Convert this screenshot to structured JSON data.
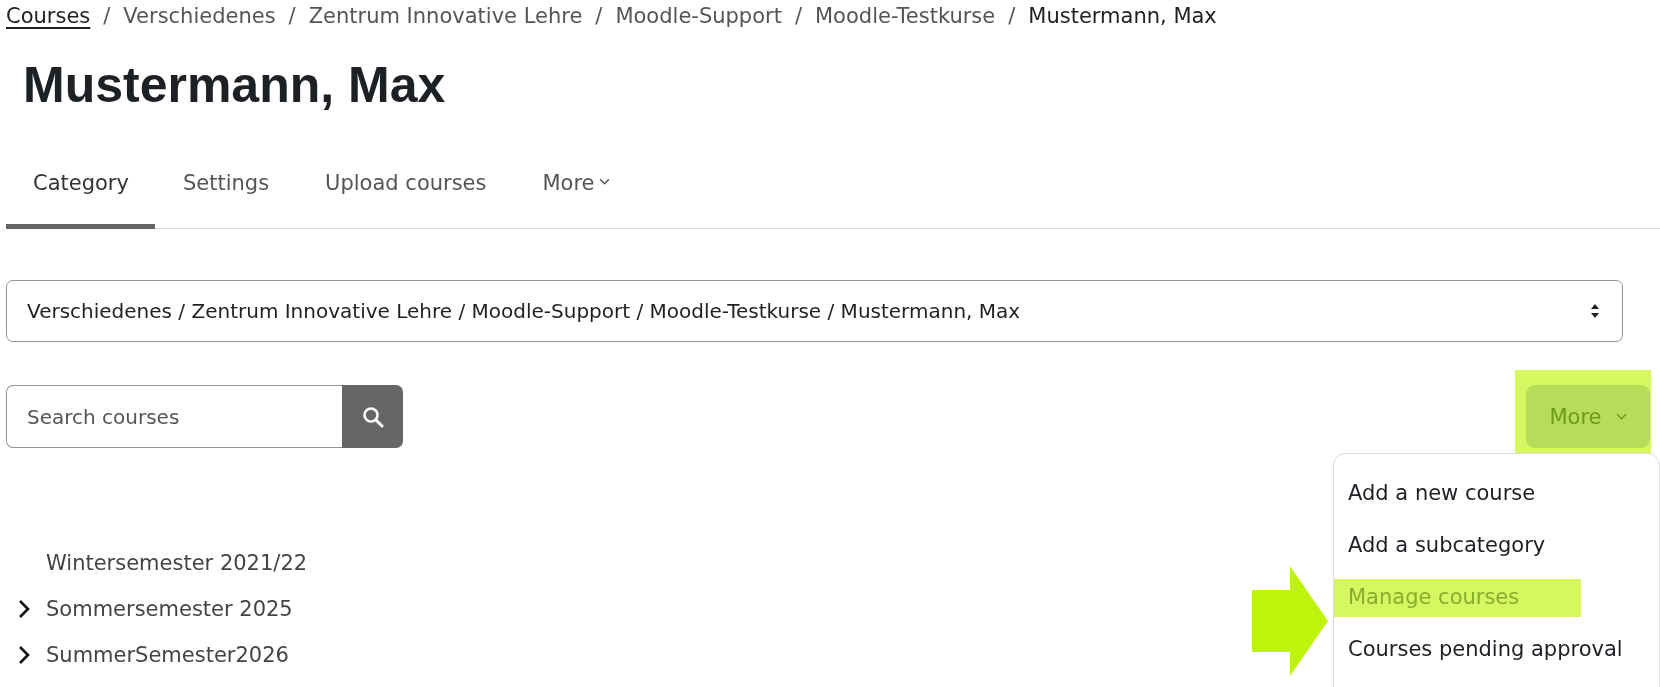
{
  "breadcrumb": [
    {
      "label": "Courses",
      "link": true
    },
    {
      "label": "Verschiedenes",
      "link": false
    },
    {
      "label": "Zentrum Innovative Lehre",
      "link": false
    },
    {
      "label": "Moodle-Support",
      "link": false
    },
    {
      "label": "Moodle-Testkurse",
      "link": false
    },
    {
      "label": "Mustermann, Max",
      "link": false
    }
  ],
  "breadcrumb_separator": "/",
  "title": "Mustermann, Max",
  "tabs": [
    {
      "label": "Category",
      "selected": true,
      "dropdown": false
    },
    {
      "label": "Settings",
      "selected": false,
      "dropdown": false
    },
    {
      "label": "Upload courses",
      "selected": false,
      "dropdown": false
    },
    {
      "label": "More",
      "selected": false,
      "dropdown": true
    }
  ],
  "category_select": {
    "value": "Verschiedenes / Zentrum Innovative Lehre / Moodle-Support / Moodle-Testkurse / Mustermann, Max"
  },
  "search": {
    "placeholder": "Search courses"
  },
  "more_button": {
    "label": "More",
    "highlighted": true
  },
  "more_menu": [
    {
      "label": "Add a new course",
      "highlighted": false
    },
    {
      "label": "Add a subcategory",
      "highlighted": false
    },
    {
      "label": "Manage courses",
      "highlighted": true
    },
    {
      "label": "Courses pending approval",
      "highlighted": false
    }
  ],
  "categories": [
    {
      "label": "Wintersemester 2021/22",
      "expandable": false
    },
    {
      "label": "Sommersemester 2025",
      "expandable": true
    },
    {
      "label": "SummerSemester2026",
      "expandable": true
    }
  ]
}
